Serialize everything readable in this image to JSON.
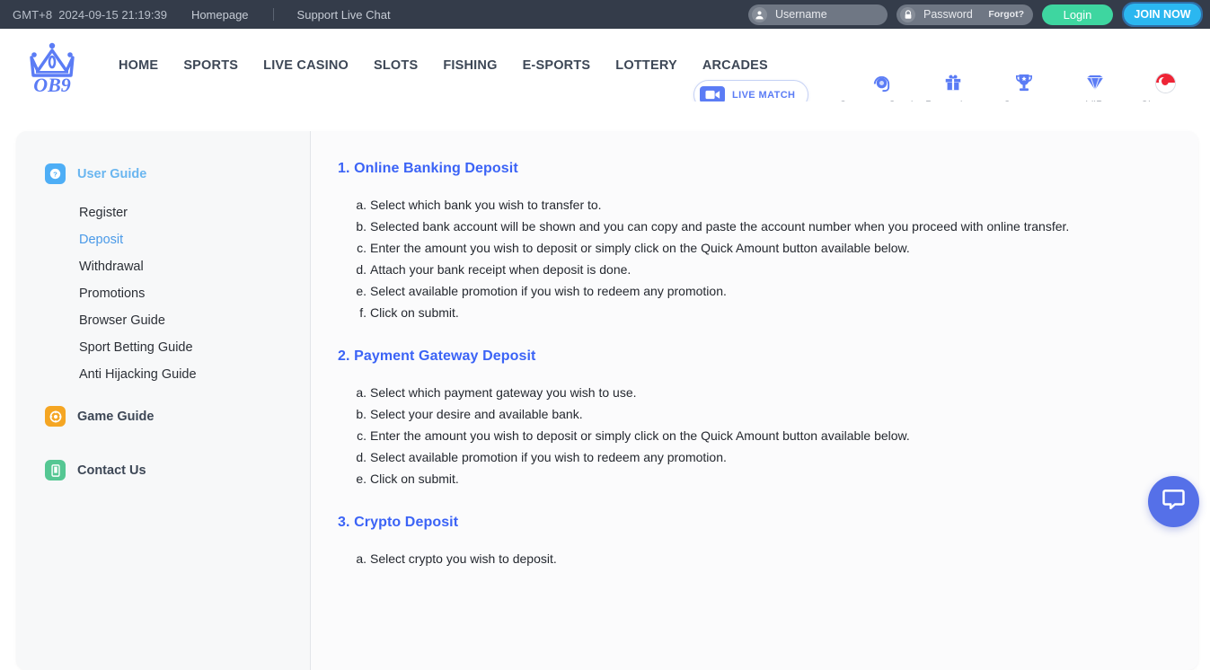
{
  "topbar": {
    "gmt": "GMT+8",
    "datetime": "2024-09-15 21:19:39",
    "homepage_link": "Homepage",
    "support_link": "Support Live Chat",
    "username_placeholder": "Username",
    "password_placeholder": "Password",
    "forgot_label": "Forgot?",
    "login_label": "Login",
    "join_label": "JOIN NOW",
    "bg_color": "#343c4a",
    "login_color": "#3ed6a0",
    "join_color": "#2bb7f0"
  },
  "header": {
    "logo_text": "OB9",
    "logo_color": "#5b7cf5",
    "nav": [
      {
        "label": "HOME"
      },
      {
        "label": "SPORTS"
      },
      {
        "label": "LIVE CASINO"
      },
      {
        "label": "SLOTS"
      },
      {
        "label": "FISHING"
      },
      {
        "label": "E-SPORTS"
      },
      {
        "label": "LOTTERY"
      },
      {
        "label": "ARCADES"
      }
    ],
    "live_match_label": "LIVE MATCH",
    "quick_links": [
      {
        "label": "Customer Service",
        "icon": "headset-icon"
      },
      {
        "label": "Promotions",
        "icon": "gift-icon"
      },
      {
        "label": "Sponsor",
        "icon": "trophy-icon"
      },
      {
        "label": "VIP",
        "icon": "diamond-icon"
      },
      {
        "label": "Singapore",
        "icon": "singapore-flag-icon"
      }
    ]
  },
  "sidebar": {
    "user_guide": {
      "label": "User Guide",
      "icon": "question-mark-icon",
      "items": [
        {
          "label": "Register",
          "active": false
        },
        {
          "label": "Deposit",
          "active": true
        },
        {
          "label": "Withdrawal",
          "active": false
        },
        {
          "label": "Promotions",
          "active": false
        },
        {
          "label": "Browser Guide",
          "active": false
        },
        {
          "label": "Sport Betting Guide",
          "active": false
        },
        {
          "label": "Anti Hijacking Guide",
          "active": false
        }
      ]
    },
    "game_guide": {
      "label": "Game Guide",
      "icon": "chip-icon"
    },
    "contact_us": {
      "label": "Contact Us",
      "icon": "phone-icon"
    }
  },
  "content": {
    "heading_color": "#3b63f6",
    "sections": [
      {
        "title": "1. Online Banking Deposit",
        "items": [
          {
            "marker": "a.",
            "text": "Select which bank you wish to transfer to."
          },
          {
            "marker": "b.",
            "text": "Selected bank account will be shown and you can copy and paste the account number when you proceed with online transfer."
          },
          {
            "marker": "c.",
            "text": "Enter the amount you wish to deposit or simply click on the Quick Amount button available below."
          },
          {
            "marker": "d.",
            "text": "Attach your bank receipt when deposit is done."
          },
          {
            "marker": "e.",
            "text": "Select available promotion if you wish to redeem any promotion."
          },
          {
            "marker": "f.",
            "text": "Click on submit."
          }
        ]
      },
      {
        "title": "2. Payment Gateway Deposit",
        "items": [
          {
            "marker": "a.",
            "text": "Select which payment gateway you wish to use."
          },
          {
            "marker": "b.",
            "text": "Select your desire and available bank."
          },
          {
            "marker": "c.",
            "text": "Enter the amount you wish to deposit or simply click on the Quick Amount button available below."
          },
          {
            "marker": "d.",
            "text": "Select available promotion if you wish to redeem any promotion."
          },
          {
            "marker": "e.",
            "text": "Click on submit."
          }
        ]
      },
      {
        "title": "3. Crypto Deposit",
        "items": [
          {
            "marker": "a.",
            "text": "Select crypto you wish to deposit."
          }
        ]
      }
    ]
  },
  "chat_widget": {
    "icon": "chat-bubble-icon",
    "color": "#5570e8"
  }
}
